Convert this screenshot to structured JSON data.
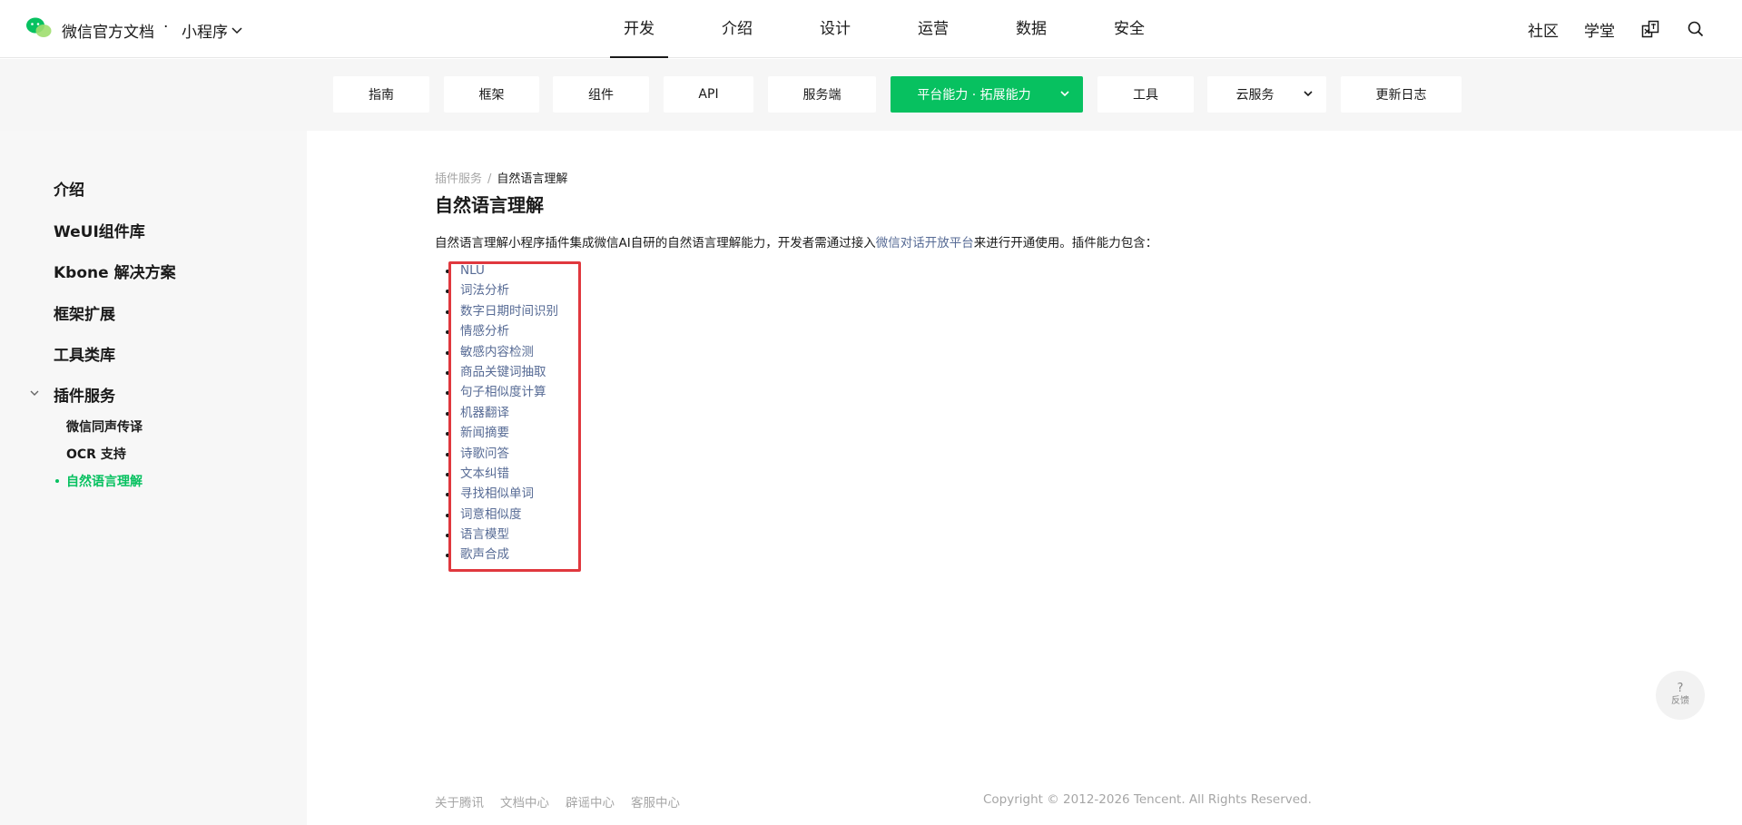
{
  "header": {
    "brand": "微信官方文档",
    "separator": "·",
    "product": "小程序",
    "nav": [
      "开发",
      "介绍",
      "设计",
      "运营",
      "数据",
      "安全"
    ],
    "active_nav": "开发",
    "community": "社区",
    "classroom": "学堂"
  },
  "subnav": {
    "items": [
      "指南",
      "框架",
      "组件",
      "API",
      "服务端",
      "平台能力 · 拓展能力",
      "工具",
      "云服务",
      "更新日志"
    ],
    "active": "平台能力 · 拓展能力"
  },
  "sidebar": {
    "items": [
      "介绍",
      "WeUI组件库",
      "Kbone 解决方案",
      "框架扩展",
      "工具类库",
      "插件服务"
    ],
    "sub_items": [
      "微信同声传译",
      "OCR 支持",
      "自然语言理解"
    ],
    "active_sub": "自然语言理解"
  },
  "breadcrumb": {
    "parent": "插件服务",
    "separator": "/",
    "current": "自然语言理解"
  },
  "page": {
    "title": "自然语言理解",
    "intro_before": "自然语言理解小程序插件集成微信AI自研的自然语言理解能力，开发者需通过接入",
    "intro_link": "微信对话开放平台",
    "intro_after": "来进行开通使用。插件能力包含：",
    "capabilities": [
      "NLU",
      "词法分析",
      "数字日期时间识别",
      "情感分析",
      "敏感内容检测",
      "商品关键词抽取",
      "句子相似度计算",
      "机器翻译",
      "新闻摘要",
      "诗歌问答",
      "文本纠错",
      "寻找相似单词",
      "词意相似度",
      "语言模型",
      "歌声合成"
    ]
  },
  "footer": {
    "links": [
      "关于腾讯",
      "文档中心",
      "辟谣中心",
      "客服中心"
    ],
    "copyright": "Copyright © 2012-2026 Tencent. All Rights Reserved."
  },
  "feedback": {
    "icon": "?",
    "label": "反馈"
  },
  "colors": {
    "accent": "#07c160",
    "link": "#576b95",
    "highlight": "#e0383e"
  }
}
